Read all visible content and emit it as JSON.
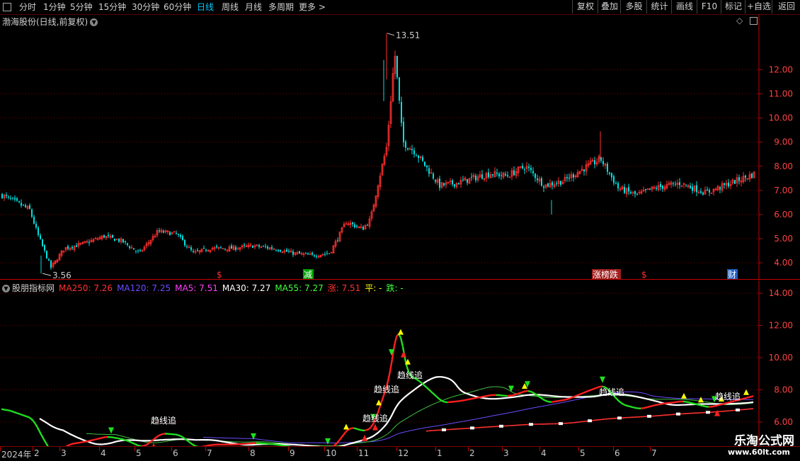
{
  "toolbar": {
    "left": [
      "分时",
      "1分钟",
      "5分钟",
      "15分钟",
      "30分钟",
      "60分钟",
      "日线",
      "周线",
      "月线",
      "多周期",
      "更多 >"
    ],
    "active": "日线",
    "right": [
      "复权",
      "叠加",
      "多股",
      "统计",
      "画线",
      "F10",
      "标记",
      "+自选",
      "返回"
    ]
  },
  "main": {
    "title": "渤海股份(日线,前复权)",
    "max_label": "13.51",
    "min_label": "3.56",
    "y_ticks": [
      "12.00",
      "11.00",
      "10.00",
      "9.00",
      "8.00",
      "7.00",
      "6.00",
      "5.00",
      "4.00"
    ],
    "events": [
      {
        "text": "$",
        "color": "#ff3030",
        "bg": ""
      },
      {
        "text": "减",
        "color": "#ffffff",
        "bg": "#00a000"
      },
      {
        "text": "涨榜跌",
        "color": "#ffffff",
        "bg": "#a02020"
      },
      {
        "text": "$",
        "color": "#ff3030",
        "bg": ""
      },
      {
        "text": "财",
        "color": "#ffffff",
        "bg": "#2060c0"
      }
    ]
  },
  "indicator": {
    "title": "股朋指标网",
    "legend": [
      {
        "text": "MA250: 7.26",
        "color": "#ff3030"
      },
      {
        "text": "MA120: 7.25",
        "color": "#6a4cff"
      },
      {
        "text": "MA5: 7.51",
        "color": "#ff40ff"
      },
      {
        "text": "MA30: 7.27",
        "color": "#ffffff"
      },
      {
        "text": "MA55: 7.27",
        "color": "#40ff40"
      },
      {
        "text": "涨: 7.51",
        "color": "#ff3030"
      },
      {
        "text": "平: -",
        "color": "#ffff00"
      },
      {
        "text": "跌: -",
        "color": "#40ff40"
      }
    ],
    "y_ticks": [
      "14.00",
      "12.00",
      "10.00",
      "8.00",
      "6.00"
    ],
    "tags": [
      "趋线追",
      "趋线追",
      "趋线追",
      "趋线追",
      "趋线追",
      "趋线追"
    ]
  },
  "xaxis": {
    "labels": [
      "2024年",
      "2",
      "3",
      "4",
      "5",
      "6",
      "7",
      "8",
      "9",
      "10",
      "11",
      "12",
      "1",
      "2",
      "3",
      "4",
      "5",
      "6",
      "7"
    ]
  },
  "watermark": {
    "line1": "乐淘公式网",
    "line2": "www.60lt.com"
  },
  "colors": {
    "up": "#ff3030",
    "down": "#00e0e0",
    "grid": "#7a0000",
    "axis": "#c80000"
  },
  "chart_data": {
    "type": "candlestick",
    "title": "渤海股份(日线,前复权)",
    "ylim": [
      3.3,
      14.3
    ],
    "x_months": [
      "2024-01",
      "2024-02",
      "2024-03",
      "2024-04",
      "2024-05",
      "2024-06",
      "2024-07",
      "2024-08",
      "2024-09",
      "2024-10",
      "2024-11",
      "2024-12",
      "2025-01",
      "2025-02",
      "2025-03",
      "2025-04",
      "2025-05",
      "2025-06",
      "2025-07"
    ],
    "close_path": [
      [
        "2024-01",
        6.8
      ],
      [
        "2024-01",
        6.2
      ],
      [
        "2024-02",
        5.2
      ],
      [
        "2024-02",
        3.8
      ],
      [
        "2024-03",
        4.6
      ],
      [
        "2024-03",
        4.8
      ],
      [
        "2024-04",
        5.1
      ],
      [
        "2024-04",
        4.9
      ],
      [
        "2024-05",
        4.4
      ],
      [
        "2024-05",
        5.3
      ],
      [
        "2024-06",
        5.2
      ],
      [
        "2024-06",
        4.4
      ],
      [
        "2024-07",
        4.6
      ],
      [
        "2024-07",
        4.6
      ],
      [
        "2024-08",
        4.7
      ],
      [
        "2024-08",
        4.6
      ],
      [
        "2024-09",
        4.4
      ],
      [
        "2024-09",
        4.3
      ],
      [
        "2024-10",
        4.4
      ],
      [
        "2024-10",
        5.7
      ],
      [
        "2024-11",
        5.4
      ],
      [
        "2024-11",
        5.8
      ],
      [
        "2024-11",
        7.4
      ],
      [
        "2024-11",
        8.8
      ],
      [
        "2024-11",
        12.7
      ],
      [
        "2024-12",
        9.0
      ],
      [
        "2024-12",
        8.6
      ],
      [
        "2024-12",
        7.9
      ],
      [
        "2025-01",
        7.2
      ],
      [
        "2025-01",
        7.3
      ],
      [
        "2025-02",
        7.5
      ],
      [
        "2025-02",
        7.7
      ],
      [
        "2025-03",
        7.6
      ],
      [
        "2025-03",
        8.0
      ],
      [
        "2025-04",
        7.2
      ],
      [
        "2025-04",
        7.4
      ],
      [
        "2025-05",
        7.9
      ],
      [
        "2025-05",
        8.3
      ],
      [
        "2025-06",
        7.1
      ],
      [
        "2025-06",
        6.8
      ],
      [
        "2025-07",
        7.1
      ],
      [
        "2025-07",
        7.3
      ],
      [
        "2025-07",
        6.9
      ],
      [
        "2025-07",
        7.7
      ]
    ],
    "indicator_series": [
      {
        "name": "MA250",
        "value": 7.26
      },
      {
        "name": "MA120",
        "value": 7.25
      },
      {
        "name": "MA5",
        "value": 7.51
      },
      {
        "name": "MA30",
        "value": 7.27
      },
      {
        "name": "MA55",
        "value": 7.27
      }
    ],
    "indicator_ylim": [
      4.5,
      14.8
    ]
  }
}
